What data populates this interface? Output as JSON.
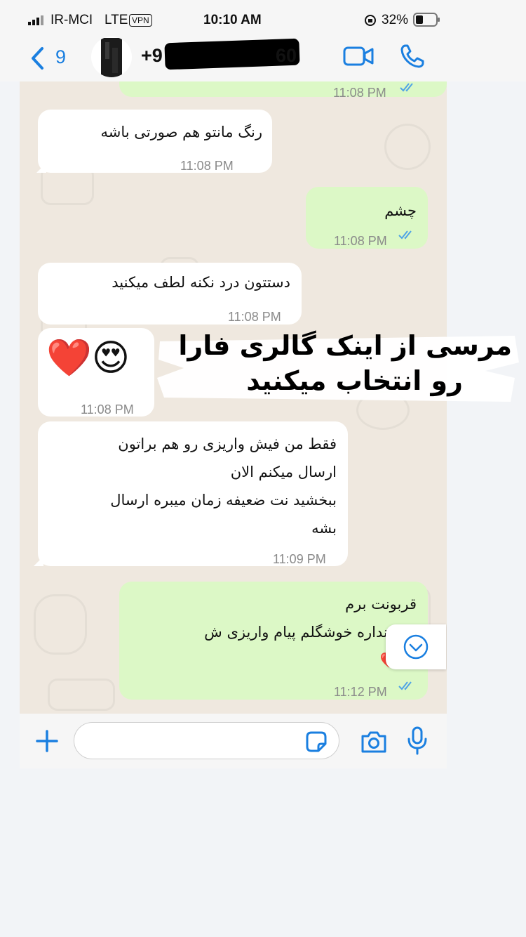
{
  "status_bar": {
    "carrier": "IR-MCI",
    "network": "LTE",
    "vpn": "VPN",
    "time": "10:10 AM",
    "battery": "32%"
  },
  "header": {
    "back_count": "9",
    "contact_prefix": "+9",
    "contact_suffix": "60",
    "icons": [
      "chevron-left-icon",
      "video-call-icon",
      "phone-call-icon"
    ]
  },
  "messages": [
    {
      "dir": "out",
      "text": "",
      "time": "11:08 PM",
      "read": true
    },
    {
      "dir": "in",
      "text": "رنگ مانتو هم صورتی باشه",
      "time": "11:08 PM"
    },
    {
      "dir": "out",
      "text": "چشم",
      "time": "11:08 PM",
      "read": true
    },
    {
      "dir": "in",
      "text": "دستتون درد نکنه لطف میکنید",
      "time": "11:08 PM"
    },
    {
      "dir": "in",
      "text": "❤️😍",
      "time": "11:08 PM"
    },
    {
      "dir": "in",
      "lines": [
        "فقط من فیش واریزی رو هم براتون",
        "ارسال میکنم الان",
        "ببخشید نت ضعیفه زمان میبره ارسال",
        "بشه"
      ],
      "time": "11:09 PM"
    },
    {
      "dir": "out",
      "lines": [
        "قربونت برم",
        "کلی نداره خوشگلم پیام واریزی ش",
        "❤️❤️"
      ],
      "time": "11:12 PM",
      "read": true
    }
  ],
  "overlay": {
    "line1": "مرسی از اینک گالری فارا",
    "line2": "رو انتخاب میکنید"
  },
  "composer": {
    "placeholder": "",
    "icons": [
      "plus-icon",
      "sticker-icon",
      "camera-icon",
      "microphone-icon"
    ]
  },
  "colors": {
    "accent": "#1a7fe0",
    "incoming_bubble": "#ffffff",
    "outgoing_bubble": "#dcf8c6",
    "chat_background": "#efe8df",
    "read_ticks": "#4fa3e6"
  }
}
